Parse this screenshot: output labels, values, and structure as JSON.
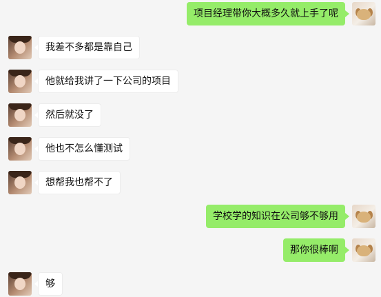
{
  "chat": {
    "messages": [
      {
        "side": "right",
        "text": "项目经理带你大概多久就上手了呢"
      },
      {
        "side": "left",
        "text": "我差不多都是靠自己"
      },
      {
        "side": "left",
        "text": "他就给我讲了一下公司的项目"
      },
      {
        "side": "left",
        "text": "然后就没了"
      },
      {
        "side": "left",
        "text": "他也不怎么懂测试"
      },
      {
        "side": "left",
        "text": "想帮我也帮不了"
      },
      {
        "side": "right",
        "text": "学校学的知识在公司够不够用"
      },
      {
        "side": "right",
        "text": "那你很棒啊"
      },
      {
        "side": "left",
        "text": "够"
      }
    ]
  },
  "colors": {
    "background": "#f5f5f5",
    "sent_bubble": "#95ec69",
    "received_bubble": "#ffffff"
  },
  "icons": {
    "sender_avatar": "user-avatar-icon",
    "contact_avatar": "contact-avatar-icon"
  }
}
